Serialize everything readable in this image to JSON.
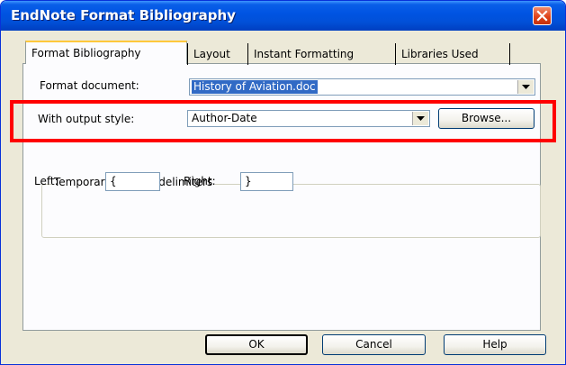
{
  "window": {
    "title": "EndNote Format Bibliography"
  },
  "tabs": [
    {
      "label": "Format Bibliography",
      "active": true
    },
    {
      "label": "Layout",
      "active": false
    },
    {
      "label": "Instant Formatting",
      "active": false
    },
    {
      "label": "Libraries Used",
      "active": false
    }
  ],
  "format_document": {
    "label": "Format document:",
    "value": "History of Aviation.doc"
  },
  "output_style": {
    "label": "With output style:",
    "value": "Author-Date",
    "browse_label": "Browse..."
  },
  "delimiters": {
    "title": "Temporary citation delimiters",
    "left_label": "Left:",
    "left_value": "{",
    "right_label": "Right:",
    "right_value": "}"
  },
  "buttons": {
    "ok": "OK",
    "cancel": "Cancel",
    "help": "Help"
  },
  "colors": {
    "highlight": "#ff0000",
    "title_bar": "#0054e3",
    "selection": "#316ac5"
  },
  "icons": [
    "close-icon",
    "dropdown-arrow-icon"
  ]
}
